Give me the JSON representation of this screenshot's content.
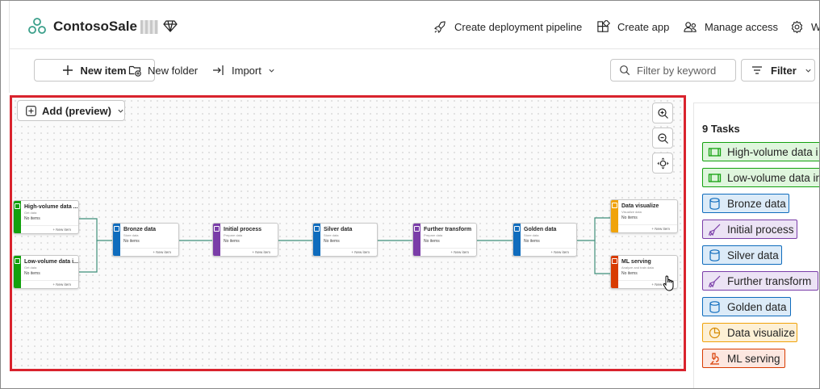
{
  "header": {
    "workspace_name": "ContosoSale",
    "actions": [
      {
        "label": "Create deployment pipeline",
        "icon": "rocket-icon"
      },
      {
        "label": "Create app",
        "icon": "app-icon"
      },
      {
        "label": "Manage access",
        "icon": "people-icon"
      },
      {
        "label": "W",
        "icon": "gear-icon"
      }
    ]
  },
  "toolbar": {
    "new_item": "New item",
    "new_folder": "New folder",
    "import": "Import",
    "filter_placeholder": "Filter by keyword",
    "filter": "Filter"
  },
  "canvas": {
    "add_button": "Add (preview)",
    "nodes": [
      {
        "title": "High-volume data ...",
        "subtitle": "Get data",
        "status": "No items",
        "new": "New item",
        "color": "#13a10e"
      },
      {
        "title": "Low-volume data i...",
        "subtitle": "Get data",
        "status": "No items",
        "new": "New item",
        "color": "#13a10e"
      },
      {
        "title": "Bronze data",
        "subtitle": "Store data",
        "status": "No items",
        "new": "New item",
        "color": "#0f6cbd"
      },
      {
        "title": "Initial process",
        "subtitle": "Prepare data",
        "status": "No items",
        "new": "New item",
        "color": "#7a3da8"
      },
      {
        "title": "Silver data",
        "subtitle": "Store data",
        "status": "No items",
        "new": "New item",
        "color": "#0f6cbd"
      },
      {
        "title": "Further transform",
        "subtitle": "Prepare data",
        "status": "No items",
        "new": "New item",
        "color": "#7a3da8"
      },
      {
        "title": "Golden data",
        "subtitle": "Store data",
        "status": "No items",
        "new": "New item",
        "color": "#0f6cbd"
      },
      {
        "title": "Data visualize",
        "subtitle": "Visualize data",
        "status": "No items",
        "new": "New item",
        "color": "#f0a30a"
      },
      {
        "title": "ML serving",
        "subtitle": "Analyze and train data",
        "status": "No items",
        "new": "New item",
        "color": "#d83b01"
      }
    ]
  },
  "panel": {
    "title": "9 Tasks",
    "tasks": [
      {
        "label": "High-volume data i",
        "icon": "get-data-icon",
        "bg": "#dff6dd",
        "border": "#13a10e"
      },
      {
        "label": "Low-volume data in",
        "icon": "get-data-icon",
        "bg": "#dff6dd",
        "border": "#13a10e"
      },
      {
        "label": "Bronze data",
        "icon": "database-icon",
        "bg": "#dcebf8",
        "border": "#0f6cbd"
      },
      {
        "label": "Initial process",
        "icon": "broom-icon",
        "bg": "#ece3f5",
        "border": "#7a3da8"
      },
      {
        "label": "Silver data",
        "icon": "database-icon",
        "bg": "#dcebf8",
        "border": "#0f6cbd"
      },
      {
        "label": "Further transform",
        "icon": "broom-icon",
        "bg": "#ece3f5",
        "border": "#7a3da8"
      },
      {
        "label": "Golden data",
        "icon": "database-icon",
        "bg": "#dcebf8",
        "border": "#0f6cbd"
      },
      {
        "label": "Data visualize",
        "icon": "pie-chart-icon",
        "bg": "#fdf0d5",
        "border": "#f0a30a"
      },
      {
        "label": "ML serving",
        "icon": "microscope-icon",
        "bg": "#fde7e0",
        "border": "#d83b01"
      }
    ]
  }
}
